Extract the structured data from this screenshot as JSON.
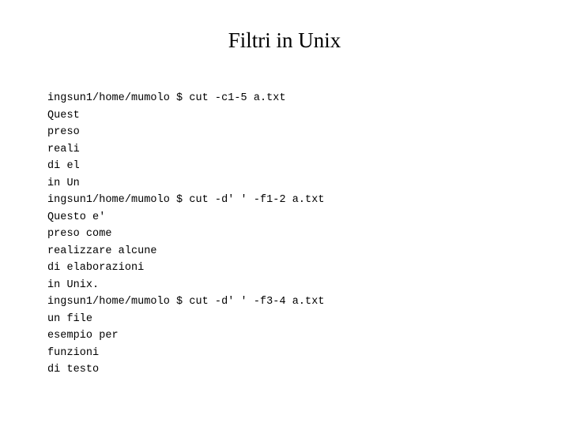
{
  "slide": {
    "title": "Filtri in Unix",
    "background_color": "#ffffff",
    "text_color": "#000000"
  },
  "terminal": {
    "prompt": "ingsun1/home/mumolo $",
    "lines": [
      {
        "kind": "command",
        "text": "ingsun1/home/mumolo $ cut -c1-5 a.txt"
      },
      {
        "kind": "output",
        "text": "Quest"
      },
      {
        "kind": "output",
        "text": "preso"
      },
      {
        "kind": "output",
        "text": "reali"
      },
      {
        "kind": "output",
        "text": "di el"
      },
      {
        "kind": "output",
        "text": "in Un"
      },
      {
        "kind": "command",
        "text": "ingsun1/home/mumolo $ cut -d' ' -f1-2 a.txt"
      },
      {
        "kind": "output",
        "text": "Questo e'"
      },
      {
        "kind": "output",
        "text": "preso come"
      },
      {
        "kind": "output",
        "text": "realizzare alcune"
      },
      {
        "kind": "output",
        "text": "di elaborazioni"
      },
      {
        "kind": "output",
        "text": "in Unix."
      },
      {
        "kind": "command",
        "text": "ingsun1/home/mumolo $ cut -d' ' -f3-4 a.txt"
      },
      {
        "kind": "output",
        "text": "un file"
      },
      {
        "kind": "output",
        "text": "esempio per"
      },
      {
        "kind": "output",
        "text": "funzioni"
      },
      {
        "kind": "output",
        "text": "di testo"
      }
    ]
  }
}
